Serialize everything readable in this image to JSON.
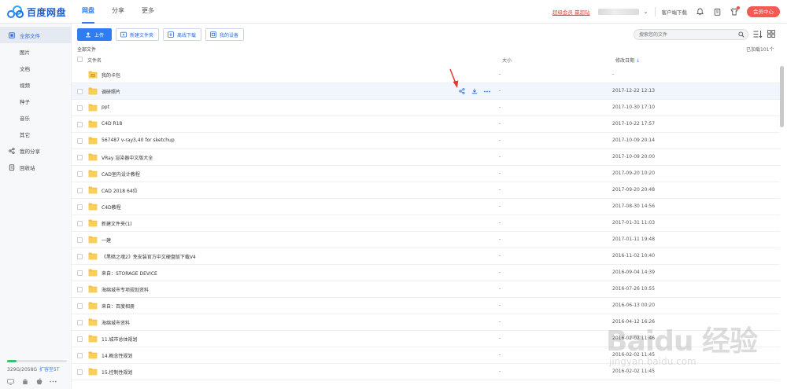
{
  "app": {
    "name": "百度网盘"
  },
  "topnav": [
    {
      "label": "网盘",
      "active": true
    },
    {
      "label": "分享",
      "active": false
    },
    {
      "label": "更多",
      "active": false
    }
  ],
  "topright": {
    "promo": "超级会员 赢超钻",
    "client_download": "客户端下载",
    "vip_center": "会员中心"
  },
  "sidebar": {
    "items": [
      {
        "label": "全部文件",
        "icon": "folder-icon",
        "active": true
      },
      {
        "label": "图片",
        "sub": true
      },
      {
        "label": "文档",
        "sub": true
      },
      {
        "label": "视频",
        "sub": true
      },
      {
        "label": "种子",
        "sub": true
      },
      {
        "label": "音乐",
        "sub": true
      },
      {
        "label": "其它",
        "sub": true
      },
      {
        "label": "我的分享",
        "icon": "share-icon"
      },
      {
        "label": "回收站",
        "icon": "trash-icon"
      }
    ],
    "quota": {
      "text": "329G/2058G",
      "expand": "扩容至5T",
      "used_fraction": 0.16
    }
  },
  "toolbar": {
    "upload": "上传",
    "new_folder": "新建文件夹",
    "offline_download": "离线下载",
    "my_devices": "我的设备"
  },
  "search": {
    "placeholder": "搜索您的文件"
  },
  "breadcrumb": "全部文件",
  "loaded": "已加载101个",
  "table": {
    "headers": {
      "name": "文件名",
      "size": "大小",
      "modified": "修改日期"
    },
    "rows": [
      {
        "name": "我的卡包",
        "size": "-",
        "date": "-",
        "special": true
      },
      {
        "name": "调研照片",
        "size": "-",
        "date": "2017-12-22 12:13",
        "hover": true
      },
      {
        "name": "ppt",
        "size": "-",
        "date": "2017-10-30 17:10"
      },
      {
        "name": "C4D R18",
        "size": "-",
        "date": "2017-10-22 17:57"
      },
      {
        "name": "567487 v-ray3,40 for sketchup",
        "size": "-",
        "date": "2017-10-09 20:14"
      },
      {
        "name": "VRay 渲染器中文版大全",
        "size": "-",
        "date": "2017-10-09 20:00"
      },
      {
        "name": "CAD室内设计教程",
        "size": "-",
        "date": "2017-09-20 10:20"
      },
      {
        "name": "CAD 2018 64位",
        "size": "-",
        "date": "2017-09-20 20:48"
      },
      {
        "name": "C4D教程",
        "size": "-",
        "date": "2017-08-30 14:56"
      },
      {
        "name": "新建文件夹(1)",
        "size": "-",
        "date": "2017-01-31 11:03"
      },
      {
        "name": "一建",
        "size": "-",
        "date": "2017-01-11 19:48"
      },
      {
        "name": "《黑暗之魂2》免安装官方中文硬盘版下载V4",
        "size": "-",
        "date": "2016-11-02 10:40"
      },
      {
        "name": "来自：STORAGE DEVICE",
        "size": "-",
        "date": "2016-09-04 14:39"
      },
      {
        "name": "海绵城市专项规划资料",
        "size": "-",
        "date": "2016-07-26 10:55"
      },
      {
        "name": "来自：百度相册",
        "size": "-",
        "date": "2016-06-13 00:20"
      },
      {
        "name": "海绵城市资料",
        "size": "-",
        "date": "2016-04-12 16:26"
      },
      {
        "name": "11.城市总体规划",
        "size": "-",
        "date": "2016-02-02 11:46"
      },
      {
        "name": "14.概念性规划",
        "size": "-",
        "date": "2016-02-02 11:45"
      },
      {
        "name": "15.控制性规划",
        "size": "-",
        "date": "2016-02-02 11:45"
      }
    ]
  },
  "watermark": {
    "line1": "Baidu 经验",
    "line2": "jingyan.baidu.com"
  },
  "colors": {
    "accent": "#2f7df0",
    "vip": "#f25a52",
    "folder": "#f5c342",
    "arrow": "#e23a32"
  }
}
